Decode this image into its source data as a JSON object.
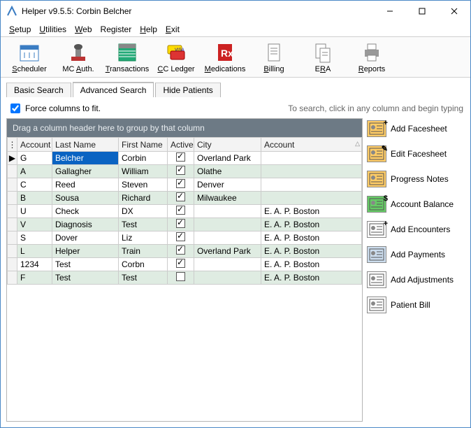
{
  "window": {
    "title": "Helper v9.5.5: Corbin Belcher"
  },
  "menu": {
    "items": [
      "Setup",
      "Utilities",
      "Web",
      "Register",
      "Help",
      "Exit"
    ]
  },
  "toolbar": [
    {
      "label": "Scheduler"
    },
    {
      "label": "MC Auth."
    },
    {
      "label": "Transactions"
    },
    {
      "label": "CC Ledger"
    },
    {
      "label": "Medications"
    },
    {
      "label": "Billing"
    },
    {
      "label": "ERA"
    },
    {
      "label": "Reports"
    }
  ],
  "tabs": {
    "basic": "Basic Search",
    "advanced": "Advanced Search",
    "hide": "Hide Patients"
  },
  "fit_label": "Force columns to fit.",
  "search_hint": "To search, click in any column and begin typing",
  "group_hint": "Drag a column header here to group by that column",
  "columns": {
    "acct": "Account",
    "last": "Last Name",
    "first": "First Name",
    "active": "Active",
    "city": "City",
    "account2": "Account"
  },
  "rows": [
    {
      "acct": "G",
      "last": "Belcher",
      "first": "Corbin",
      "active": true,
      "city": "Overland Park",
      "account2": "",
      "selected": true
    },
    {
      "acct": "A",
      "last": "Gallagher",
      "first": "William",
      "active": true,
      "city": "Olathe",
      "account2": ""
    },
    {
      "acct": "C",
      "last": "Reed",
      "first": "Steven",
      "active": true,
      "city": "Denver",
      "account2": ""
    },
    {
      "acct": "B",
      "last": "Sousa",
      "first": "Richard",
      "active": true,
      "city": "Milwaukee",
      "account2": ""
    },
    {
      "acct": "U",
      "last": "Check",
      "first": "DX",
      "active": true,
      "city": "",
      "account2": "E. A. P. Boston"
    },
    {
      "acct": "V",
      "last": "Diagnosis",
      "first": "Test",
      "active": true,
      "city": "",
      "account2": "E. A. P. Boston"
    },
    {
      "acct": "S",
      "last": "Dover",
      "first": "Liz",
      "active": true,
      "city": "",
      "account2": "E. A. P. Boston"
    },
    {
      "acct": "L",
      "last": "Helper",
      "first": "Train",
      "active": true,
      "city": "Overland Park",
      "account2": "E. A. P. Boston"
    },
    {
      "acct": "1234",
      "last": "Test",
      "first": "Corbn",
      "active": true,
      "city": "",
      "account2": "E. A. P. Boston"
    },
    {
      "acct": "F",
      "last": "Test",
      "first": "Test",
      "active": false,
      "city": "",
      "account2": "E. A. P. Boston"
    }
  ],
  "side": [
    {
      "label": "Add Facesheet",
      "corner": "+"
    },
    {
      "label": "Edit Facesheet",
      "corner": "✎"
    },
    {
      "label": "Progress Notes",
      "corner": ""
    },
    {
      "label": "Account Balance",
      "corner": "$"
    },
    {
      "label": "Add Encounters",
      "corner": "+"
    },
    {
      "label": "Add Payments",
      "corner": ""
    },
    {
      "label": "Add Adjustments",
      "corner": ""
    },
    {
      "label": "Patient Bill",
      "corner": ""
    }
  ]
}
